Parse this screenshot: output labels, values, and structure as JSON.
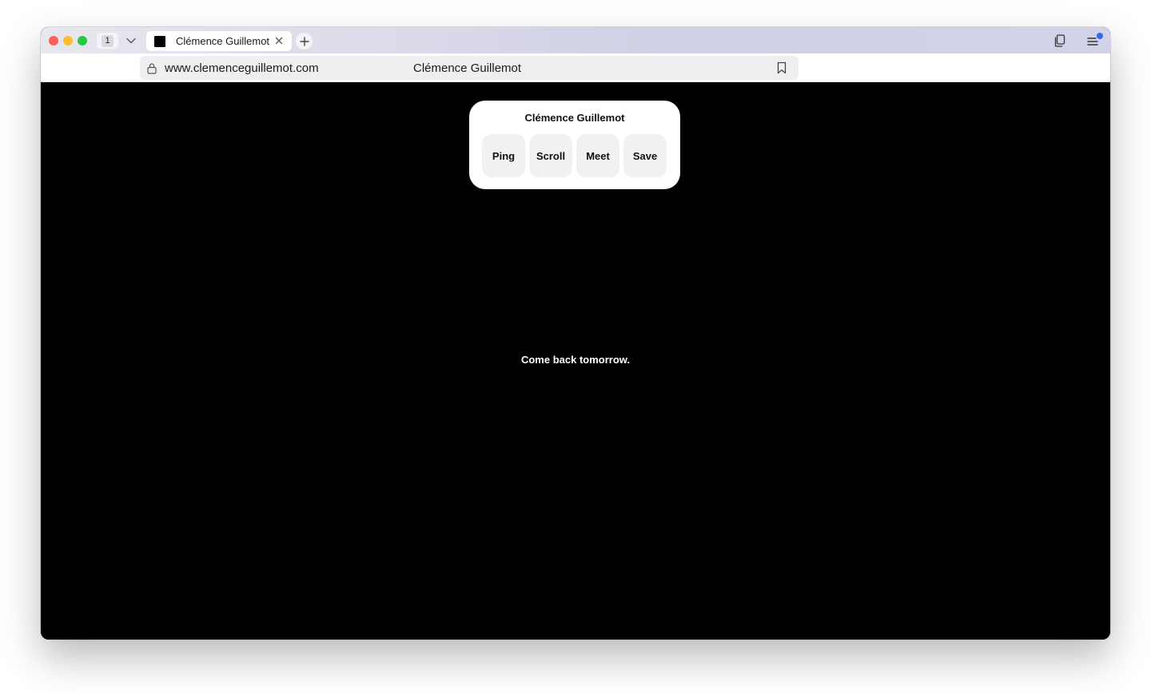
{
  "browser": {
    "tab_count": "1",
    "active_tab": {
      "title": "Clémence Guillemot"
    },
    "address": {
      "url": "www.clemenceguillemot.com",
      "page_title": "Clémence Guillemot"
    }
  },
  "page": {
    "panel": {
      "title": "Clémence Guillemot",
      "actions": [
        {
          "label": "Ping"
        },
        {
          "label": "Scroll"
        },
        {
          "label": "Meet"
        },
        {
          "label": "Save"
        }
      ]
    },
    "message": "Come back tomorrow."
  },
  "colors": {
    "page_background": "#000000",
    "panel_background": "#ffffff",
    "action_background": "#f1f1f1",
    "close_button": "#ff5f57",
    "minimize_button": "#febc2e",
    "maximize_button": "#28c840",
    "notification_dot": "#2f6bea"
  },
  "icons": [
    "chevron-down-icon",
    "close-icon",
    "plus-icon",
    "lock-icon",
    "bookmark-icon",
    "copy-tabs-icon",
    "menu-icon"
  ]
}
